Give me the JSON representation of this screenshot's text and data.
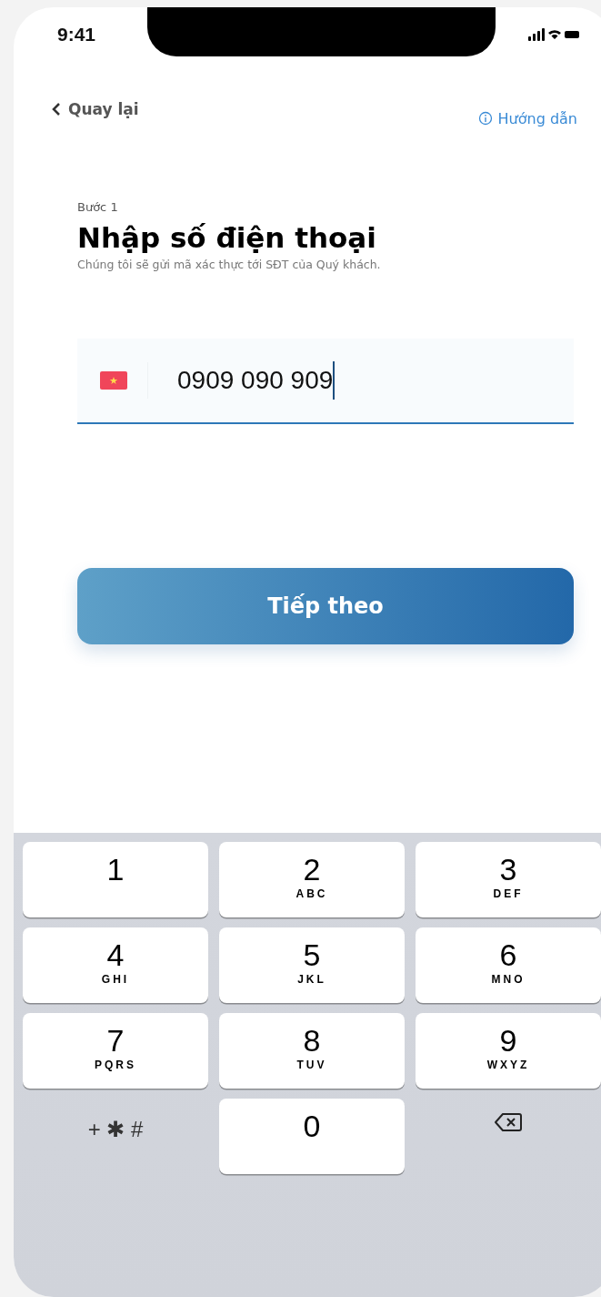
{
  "status_bar": {
    "time": "9:41"
  },
  "nav": {
    "back": "Quay lại",
    "help": "Hướng dẫn"
  },
  "step": "Bước 1",
  "title": "Nhập số điện thoại",
  "subtitle": "Chúng tôi sẽ gửi mã xác thực tới SĐT của Quý khách.",
  "phone_field": {
    "value": "0909 090 909",
    "focused": true
  },
  "next_button": "Tiếp theo",
  "keypad": [
    {
      "kind": "digit",
      "digit": "1"
    },
    {
      "kind": "digit",
      "digit": "2",
      "letters": "ABC"
    },
    {
      "kind": "digit",
      "digit": "3",
      "letters": "DEF"
    },
    {
      "kind": "digit",
      "digit": "4",
      "letters": "GHI"
    },
    {
      "kind": "digit",
      "digit": "5",
      "letters": "JKL"
    },
    {
      "kind": "digit",
      "digit": "6",
      "letters": "MNO"
    },
    {
      "kind": "digit",
      "digit": "7",
      "letters": "PQRS"
    },
    {
      "kind": "digit",
      "digit": "8",
      "letters": "TUV"
    },
    {
      "kind": "digit",
      "digit": "9",
      "letters": "WXYZ"
    },
    {
      "kind": "symbols",
      "digit": "+ ✱ #"
    },
    {
      "kind": "digit",
      "digit": "0"
    },
    {
      "kind": "delete"
    }
  ]
}
